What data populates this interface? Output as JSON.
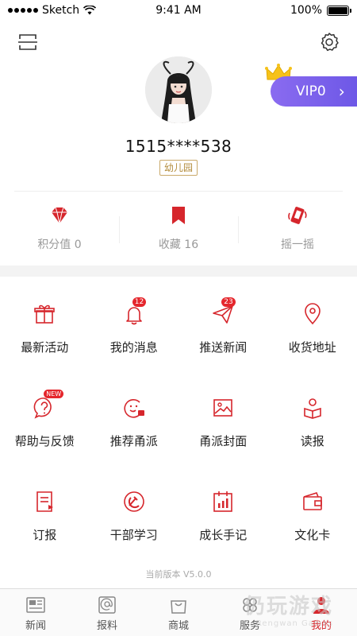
{
  "status_bar": {
    "carrier": "Sketch",
    "time": "9:41 AM",
    "battery": "100%"
  },
  "profile": {
    "phone": "1515****538",
    "level_badge": "幼儿园"
  },
  "vip": {
    "label": "VIP0",
    "arrow": "›"
  },
  "stats": [
    {
      "icon": "diamond-icon",
      "label": "积分值 0"
    },
    {
      "icon": "bookmark-icon",
      "label": "收藏 16"
    },
    {
      "icon": "shake-phone-icon",
      "label": "摇一摇"
    }
  ],
  "grid": [
    [
      {
        "icon": "gift-icon",
        "label": "最新活动"
      },
      {
        "icon": "bell-icon",
        "label": "我的消息",
        "badge": "12"
      },
      {
        "icon": "paper-plane-icon",
        "label": "推送新闻",
        "badge": "23"
      },
      {
        "icon": "location-pin-icon",
        "label": "收货地址"
      }
    ],
    [
      {
        "icon": "help-icon",
        "label": "帮助与反馈",
        "badge": "NEW"
      },
      {
        "icon": "smile-like-icon",
        "label": "推荐甬派"
      },
      {
        "icon": "image-icon",
        "label": "甬派封面"
      },
      {
        "icon": "reader-icon",
        "label": "读报"
      }
    ],
    [
      {
        "icon": "document-icon",
        "label": "订报"
      },
      {
        "icon": "party-emblem-icon",
        "label": "干部学习"
      },
      {
        "icon": "calendar-chart-icon",
        "label": "成长手记"
      },
      {
        "icon": "wallet-card-icon",
        "label": "文化卡"
      }
    ]
  ],
  "version": "当前版本 V5.0.0",
  "tabbar": [
    {
      "icon": "news-icon",
      "label": "新闻"
    },
    {
      "icon": "report-icon",
      "label": "报料"
    },
    {
      "icon": "shop-icon",
      "label": "商城"
    },
    {
      "icon": "service-icon",
      "label": "服务"
    },
    {
      "icon": "me-icon",
      "label": "我的",
      "active": true
    }
  ],
  "watermark": {
    "main": "仍玩游戏",
    "sub": "Rengwan Games"
  },
  "colors": {
    "accent": "#d6262c",
    "vip_start": "#8a6bf0",
    "vip_end": "#6c57e6",
    "badge_gold": "#b38c3c"
  }
}
